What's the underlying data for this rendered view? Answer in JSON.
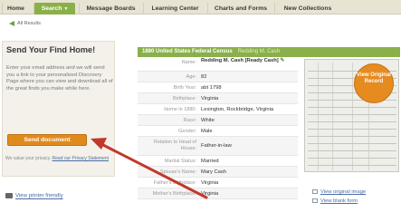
{
  "nav": {
    "tabs": [
      {
        "label": "Home"
      },
      {
        "label": "Search"
      },
      {
        "label": "Message Boards"
      },
      {
        "label": "Learning Center"
      },
      {
        "label": "Charts and Forms"
      },
      {
        "label": "New Collections"
      }
    ]
  },
  "back_link": "All Results",
  "send_panel": {
    "title": "Send Your Find Home!",
    "description": "Enter your email address and we will send you a link to your personalized Discovery Page where you can view and download all of the great finds you make while here.",
    "button_label": "Send document",
    "privacy_text": "We value your privacy.",
    "privacy_link": "Read our Privacy Statement",
    "printer_link": "View printer friendly"
  },
  "record": {
    "title": "1880 United States Federal Census",
    "subtitle": "Redding M. Cash",
    "rows": [
      {
        "label": "Name:",
        "value": "Redding M. Cash [Ready Cash]"
      },
      {
        "label": "Age:",
        "value": "82"
      },
      {
        "label": "Birth Year:",
        "value": "abt 1798"
      },
      {
        "label": "Birthplace:",
        "value": "Virginia"
      },
      {
        "label": "Home in 1880:",
        "value": "Lexington, Rockbridge, Virginia"
      },
      {
        "label": "Race:",
        "value": "White"
      },
      {
        "label": "Gender:",
        "value": "Male"
      },
      {
        "label": "Relation to Head of House:",
        "value": "Father-in-law"
      },
      {
        "label": "Marital Status:",
        "value": "Married"
      },
      {
        "label": "Spouse's Name:",
        "value": "Mary Cash"
      },
      {
        "label": "Father's Birthplace:",
        "value": "Virginia"
      },
      {
        "label": "Mother's Birthplace:",
        "value": "Virginia"
      }
    ]
  },
  "badge_label": "View Original Record",
  "image_links": {
    "view_original": "View original image",
    "view_blank": "View blank form"
  },
  "colors": {
    "nav_active": "#8ab04a",
    "record_header": "#8ab04a",
    "send_button": "#e08a1e",
    "badge": "#e58b20",
    "annotation_arrow": "#c0392b"
  },
  "icons": {
    "back": "back-arrow-icon",
    "edit": "pencil-icon",
    "printer": "printer-icon",
    "image": "image-icon",
    "form": "form-icon"
  }
}
